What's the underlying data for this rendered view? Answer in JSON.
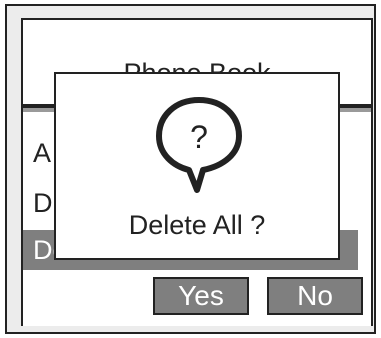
{
  "screen": {
    "title": "Phone Book",
    "items": [
      {
        "label": "A"
      },
      {
        "label": "D"
      },
      {
        "label": "De"
      }
    ]
  },
  "dialog": {
    "icon": "question-bubble-icon",
    "icon_glyph": "?",
    "message": "Delete All ?"
  },
  "buttons": {
    "yes_label": "Yes",
    "no_label": "No"
  },
  "colors": {
    "highlight": "#7f7f7f",
    "border": "#222222",
    "background": "#ececec"
  }
}
